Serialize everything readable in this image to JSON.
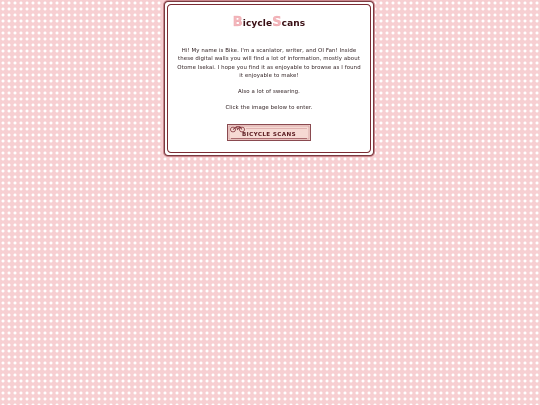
{
  "site": {
    "title_first_cap": "B",
    "title_first_rest": "icycle",
    "title_second_cap": "S",
    "title_second_rest": "cans"
  },
  "intro": {
    "paragraph": "Hi! My name is Bike. I'm a scanlator, writer, and OI Fan! Inside these digital walls you will find a lot of information, mostly about Otome Isekai. I hope you find it as enjoyable to browse as I found it enjoyable to make!",
    "swearing": "Also a lot of swearing.",
    "enter_prompt": "Click the image below to enter."
  },
  "banner": {
    "label": "BICYCLE SCANS",
    "icon": "bicycle-icon"
  },
  "colors": {
    "background": "#f7cfd2",
    "dots": "#ffffff",
    "border": "#7a2a32",
    "title_text": "#3a0f14",
    "title_cap": "#f3b6bb"
  }
}
